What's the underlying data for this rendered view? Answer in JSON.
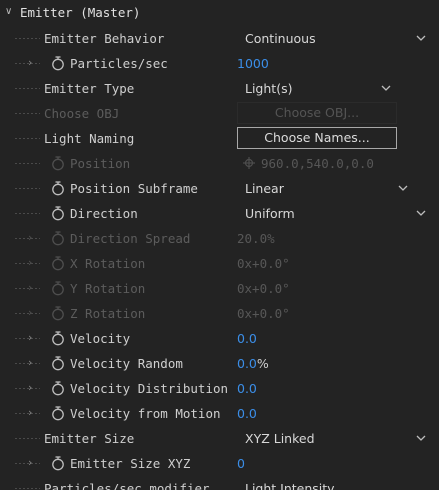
{
  "header": {
    "label": "Emitter (Master)"
  },
  "rows": {
    "emitter_behavior": {
      "label": "Emitter Behavior",
      "value": "Continuous"
    },
    "particles_sec": {
      "label": "Particles/sec",
      "value": "1000"
    },
    "emitter_type": {
      "label": "Emitter Type",
      "value": "Light(s)"
    },
    "choose_obj": {
      "label": "Choose OBJ",
      "button": "Choose OBJ..."
    },
    "light_naming": {
      "label": "Light Naming",
      "button": "Choose Names..."
    },
    "position": {
      "label": "Position",
      "value": "960.0,540.0,0.0"
    },
    "position_subframe": {
      "label": "Position Subframe",
      "value": "Linear"
    },
    "direction": {
      "label": "Direction",
      "value": "Uniform"
    },
    "direction_spread": {
      "label": "Direction Spread",
      "value": "20.0",
      "unit": "%"
    },
    "x_rotation": {
      "label": "X Rotation",
      "value": "0x+0.0°"
    },
    "y_rotation": {
      "label": "Y Rotation",
      "value": "0x+0.0°"
    },
    "z_rotation": {
      "label": "Z Rotation",
      "value": "0x+0.0°"
    },
    "velocity": {
      "label": "Velocity",
      "value": "0.0"
    },
    "velocity_random": {
      "label": "Velocity Random",
      "value": "0.0",
      "unit": "%"
    },
    "velocity_distribution": {
      "label": "Velocity Distribution",
      "value": "0.0"
    },
    "velocity_from_motion": {
      "label": "Velocity from Motion",
      "value": "0.0"
    },
    "emitter_size": {
      "label": "Emitter Size",
      "value": "XYZ Linked"
    },
    "emitter_size_xyz": {
      "label": "Emitter Size XYZ",
      "value": "0"
    },
    "particles_sec_modifier": {
      "label": "Particles/sec modifier",
      "value": "Light Intensity"
    }
  },
  "colors": {
    "accent": "#3b8ee8",
    "background": "#232323",
    "text": "#cfcfcf",
    "disabled": "#5c5c5c"
  },
  "icons": {
    "stopwatch": "stopwatch-icon",
    "twirl": "twirl-arrow-icon",
    "dropdown": "chevron-down-icon",
    "target": "crosshair-icon"
  }
}
